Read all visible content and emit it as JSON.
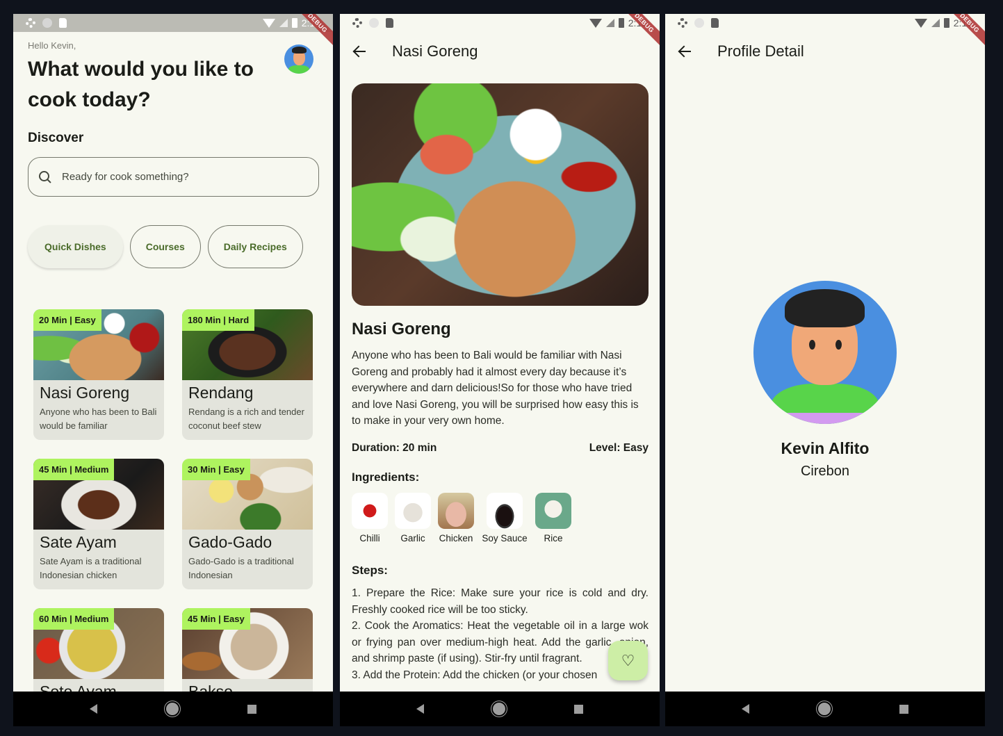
{
  "status_bar": {
    "screen1_time": "2:12",
    "screen2_time": "2:13",
    "screen3_time": "2:13",
    "debug_label": "DEBUG"
  },
  "home": {
    "greeting": "Hello Kevin,",
    "headline": "What would you like to cook today?",
    "discover_label": "Discover",
    "search": {
      "placeholder": "Ready for cook something?"
    },
    "chips": [
      {
        "label": "Quick Dishes",
        "selected": true
      },
      {
        "label": "Courses",
        "selected": false
      },
      {
        "label": "Daily Recipes",
        "selected": false
      }
    ],
    "recipes": [
      {
        "badge": "20 Min | Easy",
        "title": "Nasi Goreng",
        "desc": "Anyone who has been to Bali would be familiar"
      },
      {
        "badge": "180 Min | Hard",
        "title": "Rendang",
        "desc": "Rendang is a rich and tender coconut beef stew"
      },
      {
        "badge": "45 Min | Medium",
        "title": "Sate Ayam",
        "desc": "Sate Ayam is a traditional Indonesian chicken"
      },
      {
        "badge": "30 Min | Easy",
        "title": "Gado-Gado",
        "desc": "Gado-Gado is a traditional Indonesian"
      },
      {
        "badge": "60 Min | Medium",
        "title": "Soto Ayam",
        "desc": ""
      },
      {
        "badge": "45 Min | Easy",
        "title": "Bakso",
        "desc": ""
      }
    ]
  },
  "detail": {
    "appbar_title": "Nasi Goreng",
    "title": "Nasi Goreng",
    "description": "Anyone who has been to Bali would be familiar with Nasi Goreng and probably had it almost every day because it’s everywhere and darn delicious!So for those who have tried and love Nasi Goreng, you will be surprised how easy this is to make in your very own home.",
    "duration": "Duration: 20 min",
    "level": "Level: Easy",
    "ingredients_title": "Ingredients:",
    "ingredients": [
      {
        "name": "Chilli"
      },
      {
        "name": "Garlic"
      },
      {
        "name": "Chicken"
      },
      {
        "name": "Soy Sauce"
      },
      {
        "name": "Rice"
      }
    ],
    "steps_title": "Steps:",
    "steps": [
      "1. Prepare the Rice: Make sure your rice is cold and dry. Freshly cooked rice will be too sticky.",
      "2. Cook the Aromatics: Heat the vegetable oil in a large wok or frying pan over medium-high heat. Add the garlic, onion, and shrimp paste (if using). Stir-fry until fragrant.",
      "3. Add the Protein: Add the chicken (or your chosen"
    ],
    "fab_icon": "heart-outline",
    "fab_color": "#cdeea6"
  },
  "profile": {
    "appbar_title": "Profile Detail",
    "name": "Kevin Alfito",
    "city": "Cirebon"
  },
  "colors": {
    "background": "#f7f8f0",
    "badge": "#aef35f",
    "card": "#e3e4dc",
    "chip_text": "#4a6b2a",
    "avatar_bg": "#4a8fe0"
  }
}
